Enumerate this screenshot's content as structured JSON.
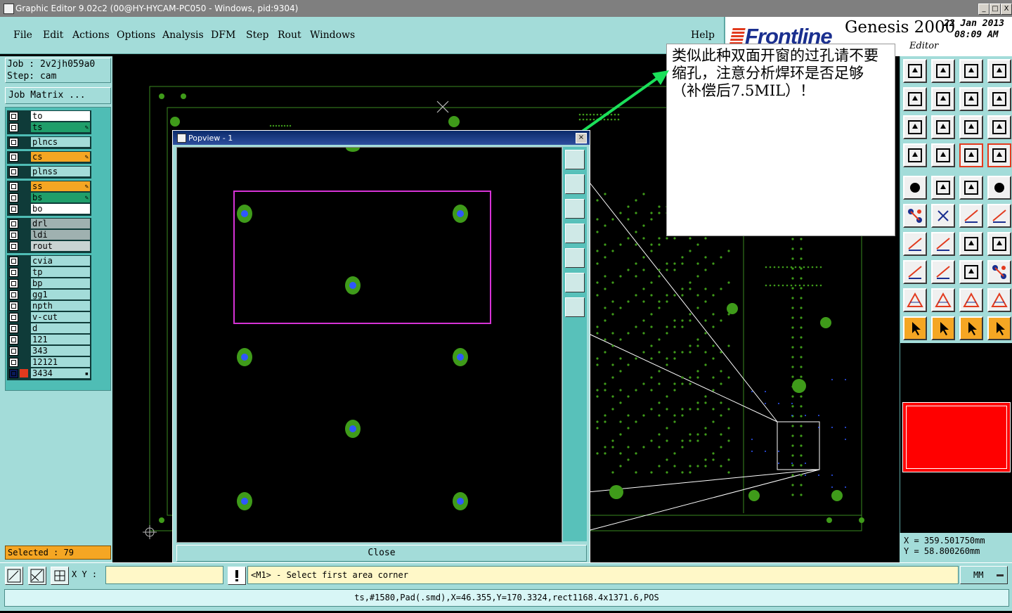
{
  "window": {
    "title": "Graphic Editor 9.02c2 (00@HY-HYCAM-PC050 - Windows, pid:9304)",
    "controls": [
      "_",
      "□",
      "X"
    ]
  },
  "menu": {
    "items": [
      "File",
      "Edit",
      "Actions",
      "Options",
      "Analysis",
      "DFM",
      "Step",
      "Rout",
      "Windows"
    ],
    "help": "Help"
  },
  "brand": {
    "logo": "Frontline",
    "product": "Genesis 2000",
    "subtitle": "Editor",
    "date": "22 Jan 2013",
    "time": "08:09 AM"
  },
  "job": {
    "job_line": "Job : 2v2jh059a0",
    "step_line": "Step: cam",
    "matrix_button": "Job Matrix ..."
  },
  "layers": {
    "group1": [
      {
        "name": "to",
        "color": "#ffffff",
        "mark": ""
      },
      {
        "name": "ts",
        "color": "#1f9e6a",
        "mark": "✎"
      }
    ],
    "group2": [
      {
        "name": "plncs",
        "color": "#a3dcd9",
        "mark": ""
      }
    ],
    "group3": [
      {
        "name": "cs",
        "color": "#f5a623",
        "mark": "✎"
      }
    ],
    "group4": [
      {
        "name": "plnss",
        "color": "#a3dcd9",
        "mark": ""
      }
    ],
    "group5": [
      {
        "name": "ss",
        "color": "#f5a623",
        "mark": "✎"
      },
      {
        "name": "bs",
        "color": "#1f9e6a",
        "mark": "✎"
      },
      {
        "name": "bo",
        "color": "#ffffff",
        "mark": ""
      }
    ],
    "group6": [
      {
        "name": "drl",
        "color": "#9fb1b0",
        "mark": ""
      },
      {
        "name": "ldi",
        "color": "#9fb1b0",
        "mark": ""
      },
      {
        "name": "rout",
        "color": "#c9d3d2",
        "mark": ""
      }
    ],
    "group7": [
      {
        "name": "cvia",
        "color": "#a3dcd9",
        "mark": ""
      },
      {
        "name": "tp",
        "color": "#a3dcd9",
        "mark": ""
      },
      {
        "name": "bp",
        "color": "#a3dcd9",
        "mark": ""
      },
      {
        "name": "gg1",
        "color": "#a3dcd9",
        "mark": ""
      },
      {
        "name": "npth",
        "color": "#a3dcd9",
        "mark": ""
      },
      {
        "name": "v-cut",
        "color": "#a3dcd9",
        "mark": ""
      },
      {
        "name": "d",
        "color": "#a3dcd9",
        "mark": ""
      },
      {
        "name": "121",
        "color": "#a3dcd9",
        "mark": ""
      },
      {
        "name": "343",
        "color": "#a3dcd9",
        "mark": ""
      },
      {
        "name": "12121",
        "color": "#a3dcd9",
        "mark": ""
      },
      {
        "name": "3434",
        "color": "#a3dcd9",
        "mark": "▪"
      }
    ]
  },
  "selected": "Selected : 79",
  "popview": {
    "title": "Popview - 1",
    "close": "Close"
  },
  "note": {
    "text": "类似此种双面开窗的过孔请不要缩孔，注意分析焊环是否足够（补偿后7.5MIL）！"
  },
  "coords": {
    "x": "X  =  359.501750mm",
    "y": "Y  =  58.800260mm"
  },
  "bottom": {
    "xy_label": "X Y :",
    "xy_value": "",
    "prompt": "<M1> - Select first area corner",
    "units": "MM"
  },
  "status": {
    "line": "ts,#1580,Pad(.smd),X=46.355,Y=170.3324,rect1168.4x1371.6,POS"
  },
  "colors": {
    "panel": "#a3dcd9",
    "pad_green": "#3f9b1a",
    "hole_blue": "#2f57ff",
    "outline_green": "#3a8a20",
    "arrow": "#1be05a",
    "select_box": "#d633d6",
    "accent_orange": "#f5a623",
    "red": "#ff0000"
  }
}
